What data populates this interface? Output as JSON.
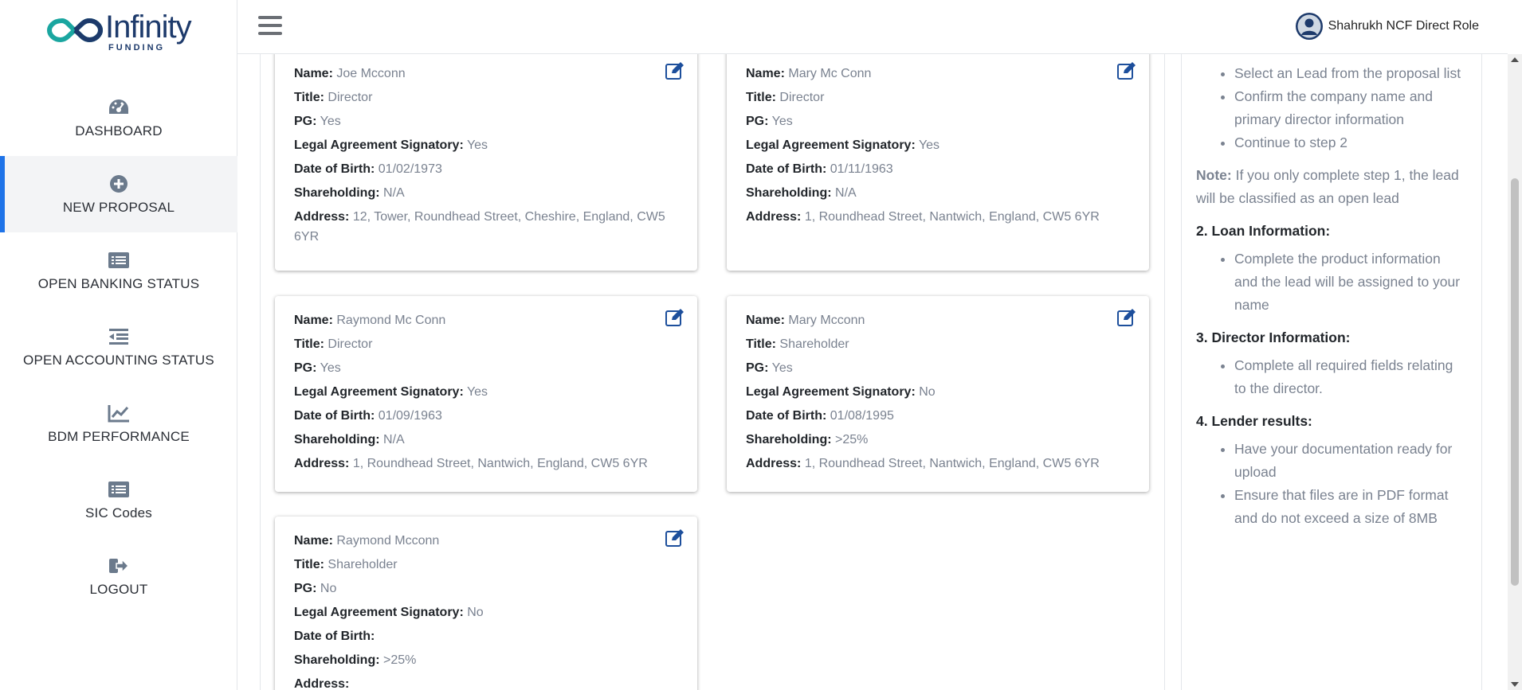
{
  "brand": {
    "name": "Infinity",
    "sub": "FUNDING"
  },
  "header": {
    "user_name": "Shahrukh NCF Direct Role"
  },
  "sidebar": {
    "items": [
      {
        "label": "DASHBOARD",
        "icon": "dashboard-icon"
      },
      {
        "label": "NEW PROPOSAL",
        "icon": "plus-circle-icon",
        "active": true
      },
      {
        "label": "OPEN BANKING STATUS",
        "icon": "list-icon"
      },
      {
        "label": "OPEN ACCOUNTING STATUS",
        "icon": "indent-icon"
      },
      {
        "label": "BDM PERFORMANCE",
        "icon": "chart-line-icon"
      },
      {
        "label": "SIC Codes",
        "icon": "list-icon"
      },
      {
        "label": "LOGOUT",
        "icon": "logout-icon"
      }
    ]
  },
  "field_labels": {
    "name": "Name:",
    "title": "Title:",
    "pg": "PG:",
    "signatory": "Legal Agreement Signatory:",
    "dob": "Date of Birth:",
    "shareholding": "Shareholding:",
    "address": "Address:"
  },
  "cards": [
    {
      "name": "Joe Mcconn",
      "title": "Director",
      "pg": "Yes",
      "signatory": "Yes",
      "dob": "01/02/1973",
      "shareholding": "N/A",
      "address": "12, Tower, Roundhead Street, Cheshire, England, CW5 6YR"
    },
    {
      "name": "Mary Mc Conn",
      "title": "Director",
      "pg": "Yes",
      "signatory": "Yes",
      "dob": "01/11/1963",
      "shareholding": "N/A",
      "address": "1, Roundhead Street, Nantwich, England, CW5 6YR"
    },
    {
      "name": "Raymond Mc Conn",
      "title": "Director",
      "pg": "Yes",
      "signatory": "Yes",
      "dob": "01/09/1963",
      "shareholding": "N/A",
      "address": "1, Roundhead Street, Nantwich, England, CW5 6YR"
    },
    {
      "name": "Mary Mcconn",
      "title": "Shareholder",
      "pg": "Yes",
      "signatory": "No",
      "dob": "01/08/1995",
      "shareholding": ">25%",
      "address": "1, Roundhead Street, Nantwich, England, CW5 6YR"
    },
    {
      "name": "Raymond Mcconn",
      "title": "Shareholder",
      "pg": "No",
      "signatory": "No",
      "dob": "",
      "shareholding": ">25%",
      "address": ""
    }
  ],
  "help": {
    "step1_items": [
      "Select an Lead from the proposal list",
      "Confirm the company name and primary director information",
      "Continue to step 2"
    ],
    "note_label": "Note:",
    "note_text": " If you only complete step 1, the lead will be classified as an open lead",
    "step2_title": "2. Loan Information:",
    "step2_items": [
      "Complete the product information and the lead will be assigned to your name"
    ],
    "step3_title": "3. Director Information:",
    "step3_items": [
      "Complete all required fields relating to the director."
    ],
    "step4_title": "4. Lender results:",
    "step4_items": [
      "Have your documentation ready for upload",
      "Ensure that files are in PDF format and do not exceed a size of 8MB"
    ]
  },
  "colors": {
    "accent": "#1e73e8",
    "brand_navy": "#1d3a6b",
    "brand_teal": "#1aa6a0",
    "label_dark": "#22262b",
    "value_gray": "#7a8290"
  }
}
